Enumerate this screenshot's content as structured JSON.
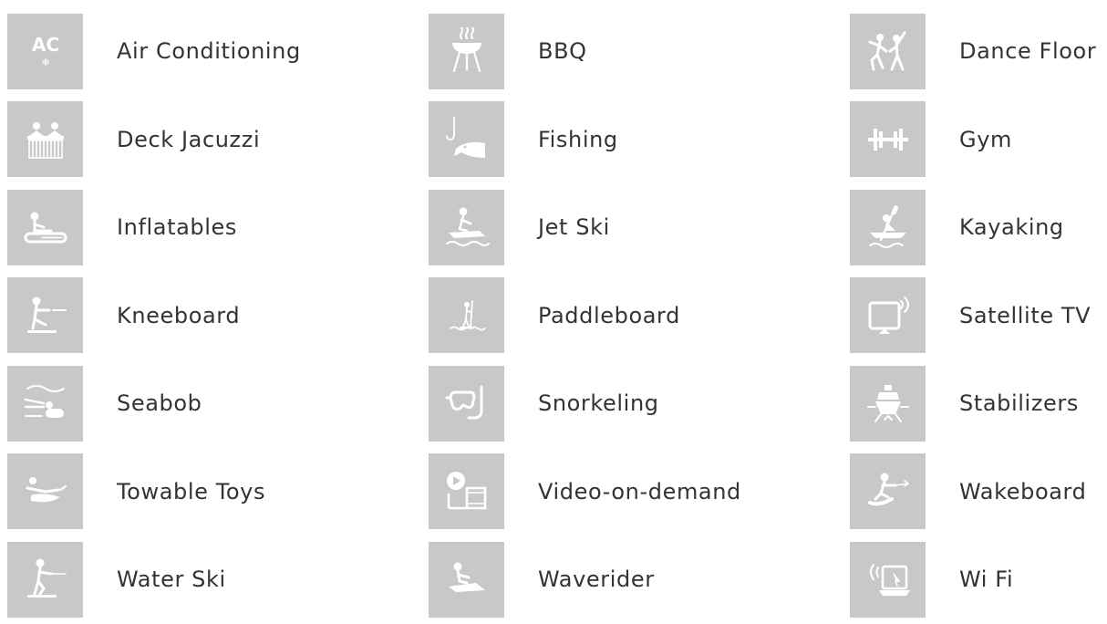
{
  "colors": {
    "tile_background": "#c8c8c8",
    "icon": "#ffffff",
    "label_text": "#333333"
  },
  "amenities": [
    {
      "label": "Air Conditioning",
      "icon": "ac-icon",
      "icon_text": "AC"
    },
    {
      "label": "BBQ",
      "icon": "bbq-icon"
    },
    {
      "label": "Dance Floor",
      "icon": "dance-floor-icon"
    },
    {
      "label": "Deck Jacuzzi",
      "icon": "jacuzzi-icon"
    },
    {
      "label": "Fishing",
      "icon": "fishing-icon"
    },
    {
      "label": "Gym",
      "icon": "gym-icon"
    },
    {
      "label": "Inflatables",
      "icon": "inflatables-icon"
    },
    {
      "label": "Jet Ski",
      "icon": "jet-ski-icon"
    },
    {
      "label": "Kayaking",
      "icon": "kayaking-icon"
    },
    {
      "label": "Kneeboard",
      "icon": "kneeboard-icon"
    },
    {
      "label": "Paddleboard",
      "icon": "paddleboard-icon"
    },
    {
      "label": "Satellite TV",
      "icon": "satellite-tv-icon"
    },
    {
      "label": "Seabob",
      "icon": "seabob-icon"
    },
    {
      "label": "Snorkeling",
      "icon": "snorkeling-icon"
    },
    {
      "label": "Stabilizers",
      "icon": "stabilizers-icon"
    },
    {
      "label": "Towable Toys",
      "icon": "towable-toys-icon"
    },
    {
      "label": "Video-on-demand",
      "icon": "video-on-demand-icon"
    },
    {
      "label": "Wakeboard",
      "icon": "wakeboard-icon"
    },
    {
      "label": "Water Ski",
      "icon": "water-ski-icon"
    },
    {
      "label": "Waverider",
      "icon": "waverider-icon"
    },
    {
      "label": "Wi Fi",
      "icon": "wifi-icon"
    }
  ]
}
